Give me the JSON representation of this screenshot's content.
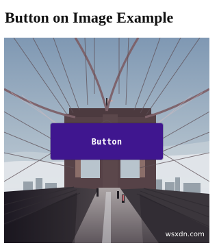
{
  "page": {
    "title": "Button on Image Example"
  },
  "image_block": {
    "button_label": "Button",
    "watermark": "wsxdn.com"
  },
  "colors": {
    "button_background": "#3f168f",
    "button_text": "#ffffff",
    "title_text": "#111111"
  }
}
